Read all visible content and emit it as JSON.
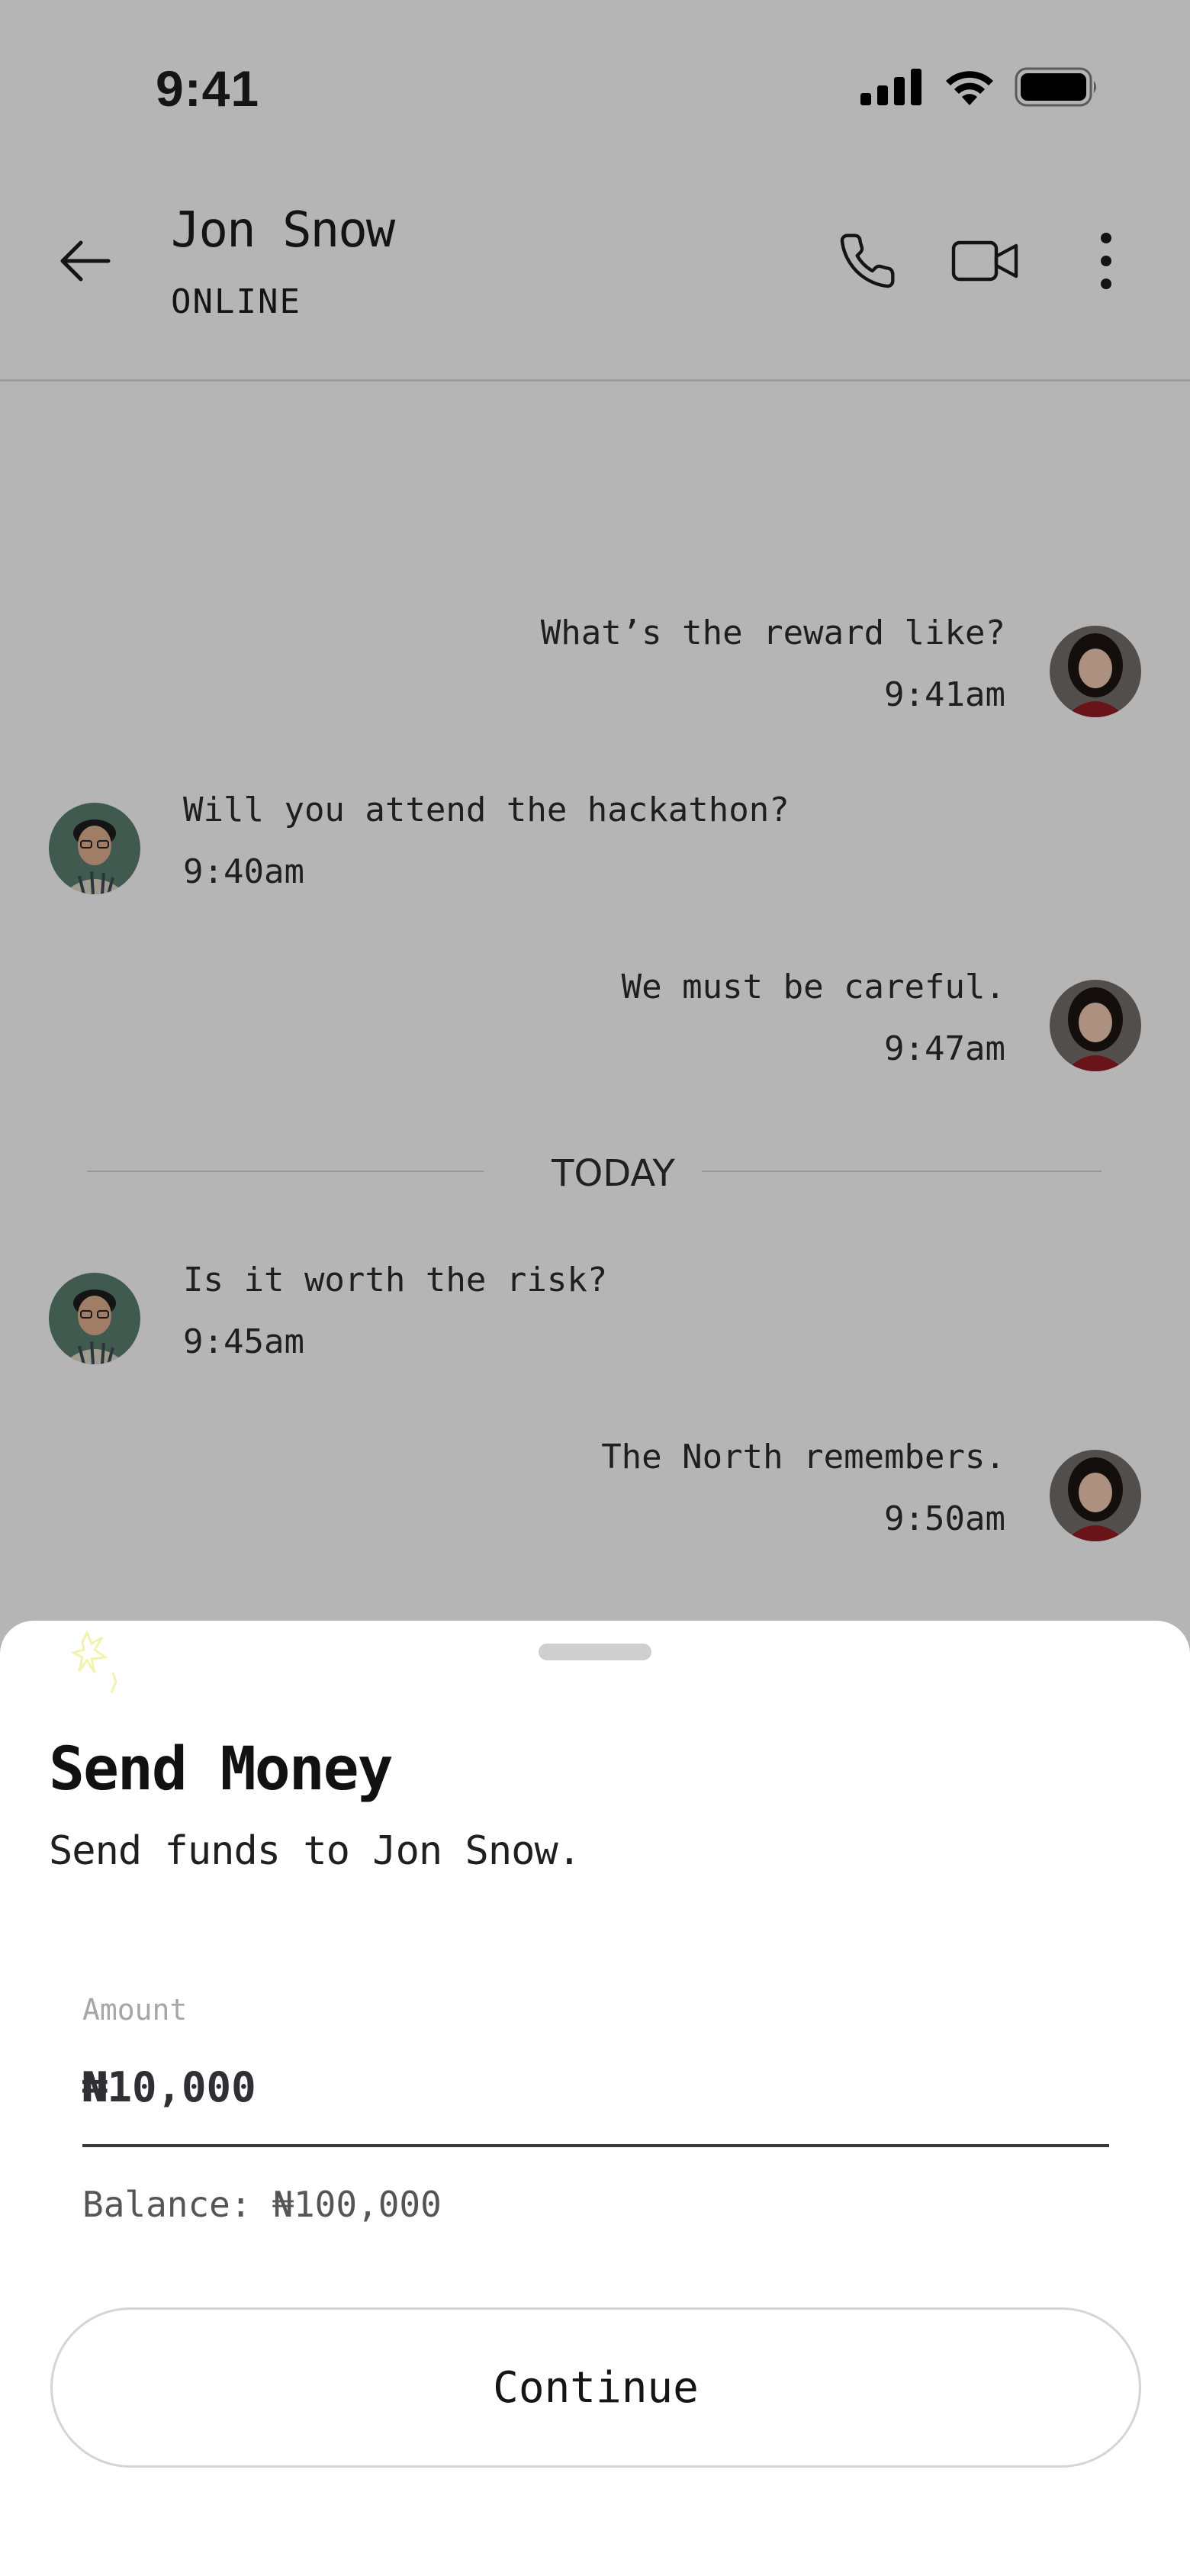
{
  "status_bar": {
    "time": "9:41",
    "icons": [
      "cellular-signal-icon",
      "wifi-icon",
      "battery-icon"
    ]
  },
  "header": {
    "name": "Jon Snow",
    "status": "ONLINE",
    "icons": [
      "back-arrow-icon",
      "phone-icon",
      "video-camera-icon",
      "more-vertical-icon"
    ]
  },
  "messages": [
    {
      "side": "right",
      "text": "What’s the reward like?",
      "time": "9:41am"
    },
    {
      "side": "left",
      "text": "Will you attend the hackathon?",
      "time": "9:40am"
    },
    {
      "side": "right",
      "text": "We must be careful.",
      "time": "9:47am"
    },
    {
      "side": "left",
      "text": "Is it worth the risk?",
      "time": "9:45am"
    },
    {
      "side": "right",
      "text": "The North remembers.",
      "time": "9:50am"
    }
  ],
  "divider_label": "TODAY",
  "sheet": {
    "title": "Send Money",
    "subtitle": "Send funds to Jon Snow.",
    "amount_label": "Amount",
    "amount_value": "₦10,000",
    "balance": "Balance: ₦100,000",
    "continue_label": "Continue"
  },
  "colors": {
    "scrim": "#bdbdbd",
    "sheet_bg": "#ffffff",
    "text_primary": "#1d1d1d",
    "muted": "#a6a6a6"
  }
}
